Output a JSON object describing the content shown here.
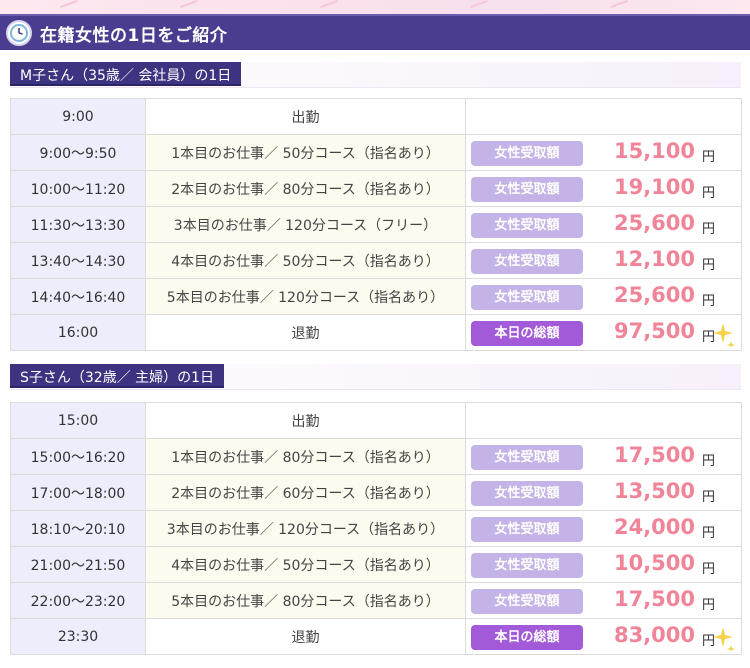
{
  "header": {
    "title": "在籍女性の1日をご紹介",
    "icon": "clock-icon"
  },
  "colors": {
    "header_bg": "#4a3d8f",
    "section_label_bg": "#3e3380",
    "price": "#f0859a",
    "badge": "#c4b3e6",
    "badge_total": "#a35ad8"
  },
  "sections": [
    {
      "title": "M子さん（35歳／ 会社員）の1日",
      "rows": [
        {
          "time": "9:00",
          "task": "出勤",
          "label": "",
          "amount": "",
          "yen": ""
        },
        {
          "time": "9:00～9:50",
          "task": "1本目のお仕事／ 50分コース（指名あり）",
          "label": "女性受取額",
          "amount": "15,100",
          "yen": "円"
        },
        {
          "time": "10:00～11:20",
          "task": "2本目のお仕事／ 80分コース（指名あり）",
          "label": "女性受取額",
          "amount": "19,100",
          "yen": "円"
        },
        {
          "time": "11:30～13:30",
          "task": "3本目のお仕事／ 120分コース（フリー）",
          "label": "女性受取額",
          "amount": "25,600",
          "yen": "円"
        },
        {
          "time": "13:40～14:30",
          "task": "4本目のお仕事／ 50分コース（指名あり）",
          "label": "女性受取額",
          "amount": "12,100",
          "yen": "円"
        },
        {
          "time": "14:40～16:40",
          "task": "5本目のお仕事／ 120分コース（指名あり）",
          "label": "女性受取額",
          "amount": "25,600",
          "yen": "円"
        },
        {
          "time": "16:00",
          "task": "退勤",
          "label": "本日の総額",
          "amount": "97,500",
          "yen": "円"
        }
      ]
    },
    {
      "title": "S子さん（32歳／ 主婦）の1日",
      "rows": [
        {
          "time": "15:00",
          "task": "出勤",
          "label": "",
          "amount": "",
          "yen": ""
        },
        {
          "time": "15:00～16:20",
          "task": "1本目のお仕事／ 80分コース（指名あり）",
          "label": "女性受取額",
          "amount": "17,500",
          "yen": "円"
        },
        {
          "time": "17:00～18:00",
          "task": "2本目のお仕事／ 60分コース（指名あり）",
          "label": "女性受取額",
          "amount": "13,500",
          "yen": "円"
        },
        {
          "time": "18:10～20:10",
          "task": "3本目のお仕事／ 120分コース（指名あり）",
          "label": "女性受取額",
          "amount": "24,000",
          "yen": "円"
        },
        {
          "time": "21:00～21:50",
          "task": "4本目のお仕事／ 50分コース（指名あり）",
          "label": "女性受取額",
          "amount": "10,500",
          "yen": "円"
        },
        {
          "time": "22:00～23:20",
          "task": "5本目のお仕事／ 80分コース（指名あり）",
          "label": "女性受取額",
          "amount": "17,500",
          "yen": "円"
        },
        {
          "time": "23:30",
          "task": "退勤",
          "label": "本日の総額",
          "amount": "83,000",
          "yen": "円"
        }
      ]
    }
  ]
}
